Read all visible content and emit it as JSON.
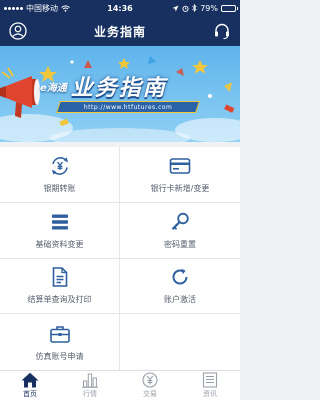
{
  "status_bar": {
    "carrier": "中国移动",
    "time": "14:36",
    "battery": "79%",
    "battery_level": 0.79
  },
  "header": {
    "title": "业务指南"
  },
  "banner": {
    "brand": "e海通",
    "title": "业务指南",
    "url": "http://www.htfutures.com"
  },
  "menu": {
    "items": [
      {
        "label": "银期转账",
        "icon": "yen-transfer-icon"
      },
      {
        "label": "银行卡新增/变更",
        "icon": "bank-card-icon"
      },
      {
        "label": "基础资料变更",
        "icon": "list-icon"
      },
      {
        "label": "密码重置",
        "icon": "key-icon"
      },
      {
        "label": "结算单查询及打印",
        "icon": "document-icon"
      },
      {
        "label": "账户激活",
        "icon": "refresh-icon"
      },
      {
        "label": "仿真账号申请",
        "icon": "briefcase-icon"
      },
      {
        "label": "",
        "icon": ""
      }
    ]
  },
  "tab_bar": {
    "tabs": [
      {
        "label": "首页",
        "icon": "home-icon",
        "active": true
      },
      {
        "label": "行情",
        "icon": "market-chart-icon",
        "active": false
      },
      {
        "label": "交易",
        "icon": "yen-circle-icon",
        "active": false
      },
      {
        "label": "资讯",
        "icon": "news-icon",
        "active": false
      }
    ]
  },
  "colors": {
    "primary": "#17305f",
    "icon_blue": "#2f5f9e",
    "banner_sky": "#5fb4ec",
    "accent_red": "#e0462f",
    "accent_yellow": "#f0c73a"
  }
}
